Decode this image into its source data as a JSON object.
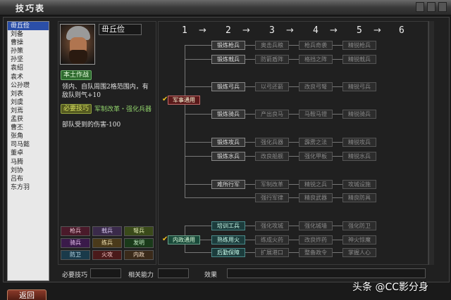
{
  "window": {
    "title": "技巧表"
  },
  "sidebar": {
    "items": [
      {
        "label": "毌丘俭",
        "selected": true
      },
      {
        "label": "刘备"
      },
      {
        "label": "曹操"
      },
      {
        "label": "孙策"
      },
      {
        "label": "孙坚"
      },
      {
        "label": "袁绍"
      },
      {
        "label": "袁术"
      },
      {
        "label": "公孙瓒"
      },
      {
        "label": "刘表"
      },
      {
        "label": "刘虞"
      },
      {
        "label": "刘焉"
      },
      {
        "label": "孟获"
      },
      {
        "label": "曹丕"
      },
      {
        "label": "张角"
      },
      {
        "label": "司马懿"
      },
      {
        "label": "董卓"
      },
      {
        "label": "马腾"
      },
      {
        "label": "刘协"
      },
      {
        "label": "吕布"
      },
      {
        "label": "东方羽"
      }
    ]
  },
  "detail": {
    "name": "毌丘俭",
    "skill_badge": "本土作战",
    "description": "领内、自队周围2格范围内，有敌队则气+10",
    "condition_badge": "必要技巧",
    "condition_text": "军制改革・强化兵器",
    "effect_text": "部队受到的伤害-100"
  },
  "tree": {
    "columns": [
      "1",
      "2",
      "3",
      "4",
      "5",
      "6"
    ],
    "arrow": "→",
    "roots": [
      {
        "label": "军事通用",
        "checked": true
      },
      {
        "label": "内政通用",
        "checked": true
      }
    ],
    "military_rows": [
      [
        "锻炼枪兵",
        "奥击兵粮",
        "枪兵奇袭",
        "精锐枪兵"
      ],
      [
        "锻炼戟兵",
        "防箭盾阵",
        "格挡之阵",
        "精锐戟兵"
      ],
      [
        "锻炼弓兵",
        "以弓还箭",
        "改良弓弩",
        "精锐弓兵"
      ],
      [
        "锻炼骑兵",
        "产出良马",
        "马鞍马镫",
        "精锐骑兵"
      ],
      [
        "锻炼攻兵",
        "强化兵器",
        "霹雳之法",
        "精锐攻兵"
      ],
      [
        "锻炼水兵",
        "改良船舰",
        "强化甲板",
        "精锐水兵"
      ],
      [
        "难所行军",
        "军制改革",
        "精锐之兵",
        "攻城设施"
      ],
      [
        "",
        "强行军律",
        "精良武器",
        "精良防具"
      ]
    ],
    "civil_rows": [
      [
        "培训工兵",
        "强化攻城",
        "强化城墙",
        "强化防卫"
      ],
      [
        "熟练用火",
        "练成火药",
        "改良炸药",
        "神火惊魔"
      ],
      [
        "后勤保障",
        "扩展港口",
        "整备政令",
        "掌握人心"
      ]
    ]
  },
  "unit_types": [
    [
      "枪兵",
      "戟兵",
      "弩兵"
    ],
    [
      "骑兵",
      "练兵",
      "发明"
    ],
    [
      "防卫",
      "火攻",
      "内政"
    ]
  ],
  "bottom": {
    "required_label": "必要技巧",
    "related_label": "相关能力",
    "effect_label": "效果"
  },
  "back_button": "返回",
  "watermark": "头条 @CC影分身"
}
